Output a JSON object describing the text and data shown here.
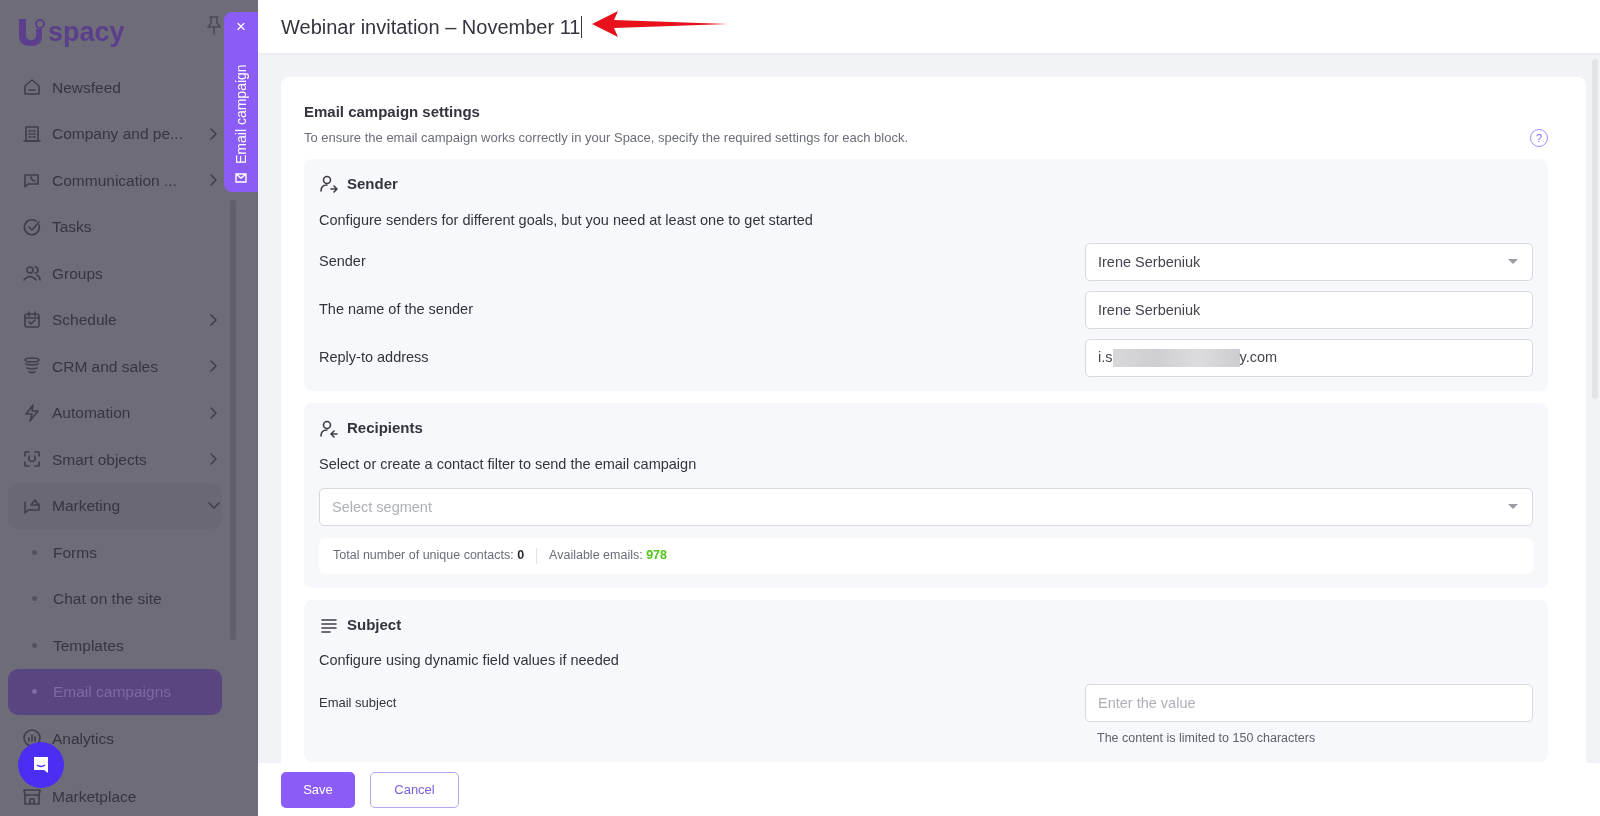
{
  "sidebar": {
    "logo": "spacy",
    "items": [
      {
        "label": "Newsfeed",
        "selected": false
      },
      {
        "label": "Company and pe...",
        "selected": false,
        "expanded": false
      },
      {
        "label": "Communication ...",
        "selected": false,
        "expanded": false
      },
      {
        "label": "Tasks",
        "selected": false
      },
      {
        "label": "Groups",
        "selected": false
      },
      {
        "label": "Schedule",
        "selected": false,
        "expanded": false
      },
      {
        "label": "CRM and sales",
        "selected": false,
        "expanded": false
      },
      {
        "label": "Automation",
        "selected": false,
        "expanded": false
      },
      {
        "label": "Smart objects",
        "selected": false,
        "expanded": false
      },
      {
        "label": "Marketing",
        "selected": false,
        "expanded": true,
        "children": [
          {
            "label": "Forms",
            "selected": false
          },
          {
            "label": "Chat on the site",
            "selected": false
          },
          {
            "label": "Templates",
            "selected": false
          },
          {
            "label": "Email campaigns",
            "selected": true
          }
        ]
      },
      {
        "label": "Analytics",
        "selected": false
      },
      {
        "label": "Marketplace",
        "selected": false
      }
    ]
  },
  "side_tab": {
    "label": "Email campaign",
    "close": "×"
  },
  "header": {
    "title": "Webinar invitation – November 11"
  },
  "settings": {
    "title": "Email campaign settings",
    "description": "To ensure the email campaign works correctly in your Space, specify the required settings for each block.",
    "help": "?"
  },
  "sections": [
    {
      "kind": "sender",
      "title": "Sender",
      "description": "Configure senders for different goals, but you need at least one to get started",
      "fields": [
        {
          "kind": "select",
          "label": "Sender",
          "value": "Irene Serbeniuk"
        },
        {
          "kind": "text",
          "label": "The name of the sender",
          "value": "Irene Serbeniuk"
        },
        {
          "kind": "redacted",
          "label": "Reply-to address",
          "value_start": "i.s",
          "value_end": "y.com"
        }
      ]
    },
    {
      "kind": "recipients",
      "title": "Recipients",
      "description": "Select or create a contact filter to send the email campaign",
      "segment": {
        "placeholder": "Select segment"
      },
      "stats": [
        {
          "label": "Total number of unique contacts:",
          "value": "0",
          "color": "#2b2b33"
        },
        {
          "label": "Available emails:",
          "value": "978",
          "color": "#52c41a"
        }
      ]
    },
    {
      "kind": "subject",
      "title": "Subject",
      "description": "Configure using dynamic field values if needed",
      "fields": [
        {
          "kind": "text",
          "label": "Email subject",
          "placeholder": "Enter the value",
          "hint": "The content is limited to 150 characters"
        }
      ]
    }
  ],
  "footer": {
    "buttons": [
      {
        "label": "Save",
        "kind": "primary"
      },
      {
        "label": "Cancel",
        "kind": "outline"
      }
    ]
  }
}
